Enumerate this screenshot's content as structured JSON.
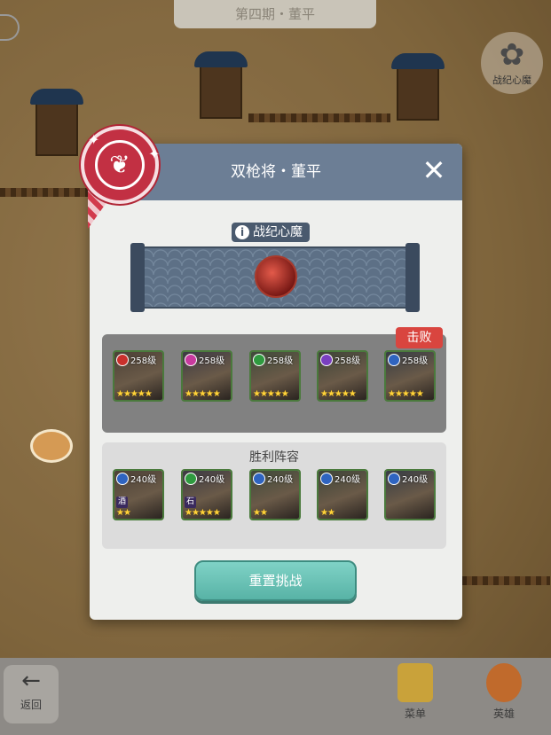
{
  "top_bar": {
    "title": "第四期・董平"
  },
  "heart_button": {
    "icon": "heart-demon-icon",
    "label": "战纪心魔"
  },
  "bottom_bar": {
    "back_label": "返回",
    "items": [
      {
        "label": "菜单",
        "icon": "menu-scroll-icon"
      },
      {
        "label": "英雄",
        "icon": "hero-rooster-icon"
      }
    ]
  },
  "modal": {
    "title": "双枪将・董平",
    "close_icon": "close-icon",
    "demon_label": "战纪心魔",
    "defeat_tag": "击败",
    "victory_title": "胜利阵容",
    "reset_button": "重置挑战",
    "enemy_team": [
      {
        "level": "258级",
        "element": "fire",
        "color": "#c9302c",
        "stars": "★★★★★"
      },
      {
        "level": "258级",
        "element": "heart",
        "color": "#c83a9e",
        "stars": "★★★★★"
      },
      {
        "level": "258级",
        "element": "wood",
        "color": "#2f9a3f",
        "stars": "★★★★★"
      },
      {
        "level": "258级",
        "element": "moon",
        "color": "#7a3fc0",
        "stars": "★★★★★"
      },
      {
        "level": "258级",
        "element": "water",
        "color": "#2f64c0",
        "stars": "★★★★★"
      }
    ],
    "victory_team": [
      {
        "level": "240级",
        "element": "water",
        "color": "#2f64c0",
        "stars": "★★",
        "tag": "酒"
      },
      {
        "level": "240级",
        "element": "wood",
        "color": "#2f9a3f",
        "stars": "★★★★★",
        "tag": "石"
      },
      {
        "level": "240级",
        "element": "water",
        "color": "#2f64c0",
        "stars": "★★",
        "tag": ""
      },
      {
        "level": "240级",
        "element": "water",
        "color": "#2f64c0",
        "stars": "★★",
        "tag": ""
      },
      {
        "level": "240级",
        "element": "water",
        "color": "#2f64c0",
        "stars": "",
        "tag": ""
      }
    ]
  }
}
